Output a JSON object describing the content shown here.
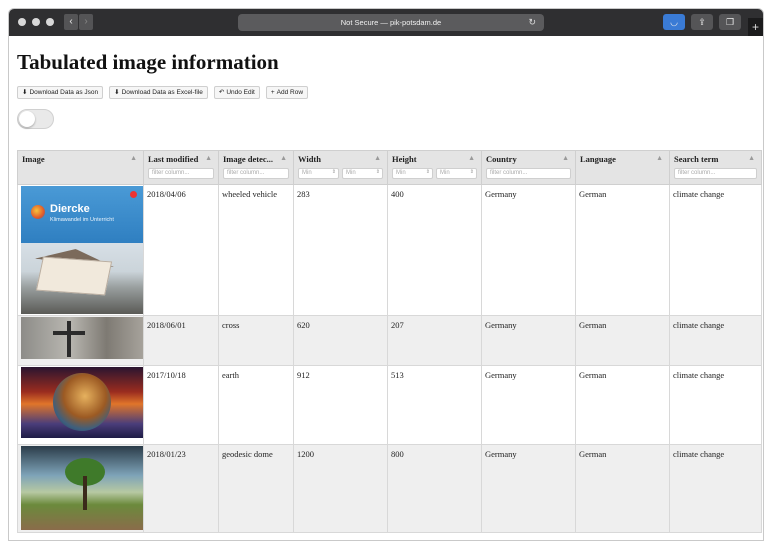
{
  "browser": {
    "address": "Not Secure — pik-potsdam.de",
    "back_icon": "chevron-left-icon",
    "forward_icon": "chevron-right-icon",
    "reload_icon": "reload-icon"
  },
  "page": {
    "title": "Tabulated image information",
    "buttons": {
      "download_json": "Download Data as Json",
      "download_excel": "Download Data as Excel-file",
      "undo": "Undo Edit",
      "add_row": "Add Row"
    }
  },
  "table": {
    "columns": [
      {
        "label": "Image"
      },
      {
        "label": "Last modified",
        "filter": "filter column..."
      },
      {
        "label": "Image detec...",
        "filter": "filter column..."
      },
      {
        "label": "Width",
        "min1": "Min",
        "min2": "Min"
      },
      {
        "label": "Height",
        "min1": "Min",
        "min2": "Min"
      },
      {
        "label": "Country",
        "filter": "filter column..."
      },
      {
        "label": "Language"
      },
      {
        "label": "Search term",
        "filter": "filter column..."
      }
    ],
    "rows": [
      {
        "date": "2018/04/06",
        "detect": "wheeled vehicle",
        "width": "283",
        "height": "400",
        "country": "Germany",
        "language": "German",
        "search": "climate change",
        "image_title": "Diercke",
        "image_sub": "Klimawandel im Unterricht"
      },
      {
        "date": "2018/06/01",
        "detect": "cross",
        "width": "620",
        "height": "207",
        "country": "Germany",
        "language": "German",
        "search": "climate change"
      },
      {
        "date": "2017/10/18",
        "detect": "earth",
        "width": "912",
        "height": "513",
        "country": "Germany",
        "language": "German",
        "search": "climate change"
      },
      {
        "date": "2018/01/23",
        "detect": "geodesic dome",
        "width": "1200",
        "height": "800",
        "country": "Germany",
        "language": "German",
        "search": "climate change"
      }
    ]
  }
}
